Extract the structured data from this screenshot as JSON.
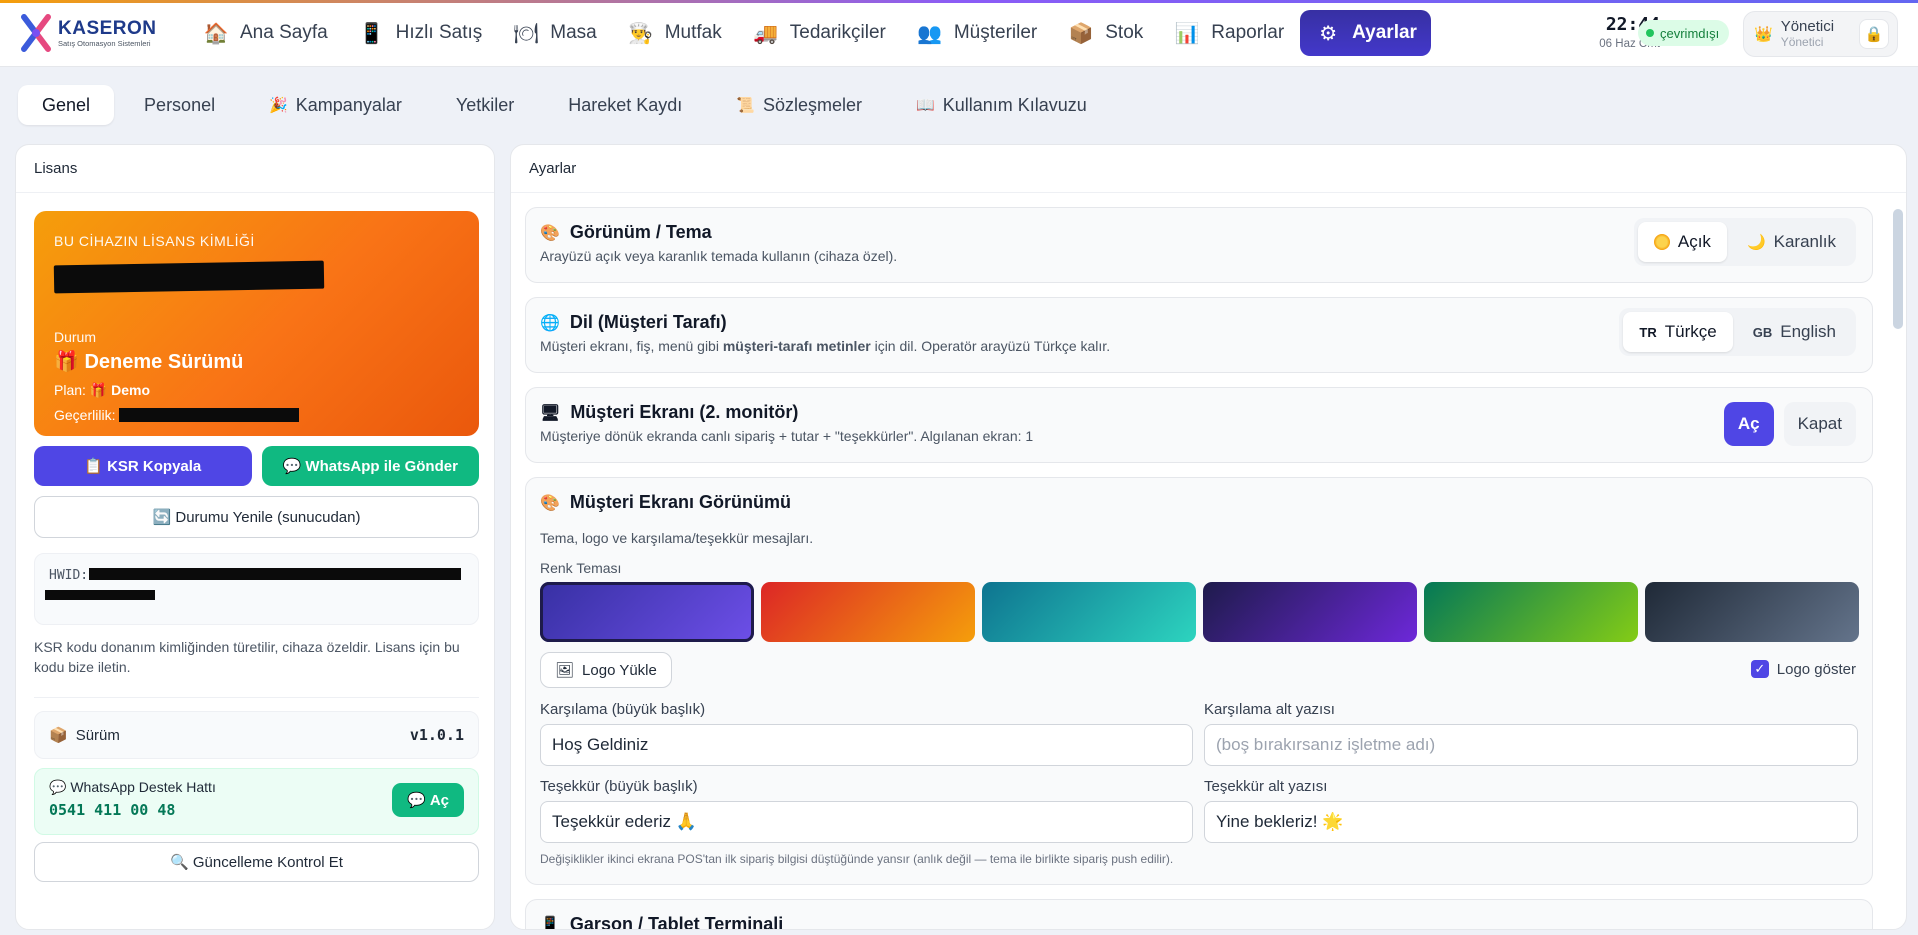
{
  "brand": {
    "name": "KASERON",
    "sub": "Satış Otomasyon Sistemleri"
  },
  "nav": [
    {
      "label": "Ana Sayfa",
      "icon": "🏠"
    },
    {
      "label": "Hızlı Satış",
      "icon": "📱"
    },
    {
      "label": "Masa",
      "icon": "🍽"
    },
    {
      "label": "Mutfak",
      "icon": "👨‍🍳"
    },
    {
      "label": "Tedarikçiler",
      "icon": "🚚"
    },
    {
      "label": "Müşteriler",
      "icon": "👥"
    },
    {
      "label": "Stok",
      "icon": "📦"
    },
    {
      "label": "Raporlar",
      "icon": "📊"
    },
    {
      "label": "Ayarlar",
      "icon": "⚙"
    }
  ],
  "clock": {
    "time": "22:44",
    "date": "06 Haz Cmt"
  },
  "connection": {
    "label": "çevrimdışı"
  },
  "user": {
    "name": "Yönetici",
    "role": "Yönetici"
  },
  "tabs": [
    {
      "label": "Genel",
      "icon": ""
    },
    {
      "label": "Personel",
      "icon": ""
    },
    {
      "label": "Kampanyalar",
      "icon": "🎉"
    },
    {
      "label": "Yetkiler",
      "icon": ""
    },
    {
      "label": "Hareket Kaydı",
      "icon": ""
    },
    {
      "label": "Sözleşmeler",
      "icon": "📜"
    },
    {
      "label": "Kullanım Kılavuzu",
      "icon": "📖"
    }
  ],
  "license": {
    "panel_title": "Lisans",
    "card_title": "BU CİHAZIN LİSANS KİMLİĞİ",
    "status_label": "Durum",
    "status": "Deneme Sürümü",
    "plan_label": "Plan:",
    "plan": "Demo",
    "valid_label": "Geçerlilik:",
    "copy_btn": "KSR Kopyala",
    "whatsapp_btn": "WhatsApp ile Gönder",
    "refresh_btn": "Durumu Yenile (sunucudan)",
    "hwid_label": "HWID:",
    "note": "KSR kodu donanım kimliğinden türetilir, cihaza özeldir. Lisans için bu kodu bize iletin.",
    "version_label": "Sürüm",
    "version": "v1.0.1",
    "support_title": "WhatsApp Destek Hattı",
    "support_phone": "0541 411 00 48",
    "support_open": "Aç",
    "update_btn": "Güncelleme Kontrol Et"
  },
  "settings": {
    "panel_title": "Ayarlar",
    "theme": {
      "title": "Görünüm / Tema",
      "desc": "Arayüzü açık veya karanlık temada kullanın (cihaza özel).",
      "light": "Açık",
      "dark": "Karanlık",
      "selected": "Açık"
    },
    "language": {
      "title": "Dil (Müşteri Tarafı)",
      "desc_pre": "Müşteri ekranı, fiş, menü gibi ",
      "desc_bold": "müşteri-tarafı metinler",
      "desc_post": " için dil. Operatör arayüzü Türkçe kalır.",
      "tr_code": "TR",
      "tr": "Türkçe",
      "en_code": "GB",
      "en": "English",
      "selected": "Türkçe"
    },
    "customer_display": {
      "title": "Müşteri Ekranı (2. monitör)",
      "desc": "Müşteriye dönük ekranda canlı sipariş + tutar + \"teşekkürler\". Algılanan ekran: 1",
      "on": "Aç",
      "off": "Kapat"
    },
    "display_look": {
      "title": "Müşteri Ekranı Görünümü",
      "desc": "Tema, logo ve karşılama/teşekkür mesajları.",
      "color_theme_label": "Renk Teması",
      "swatches": [
        {
          "from": "#3730a3",
          "to": "#6d4fe8",
          "selected": true
        },
        {
          "from": "#dc2626",
          "to": "#f59e0b",
          "selected": false
        },
        {
          "from": "#0e7490",
          "to": "#2dd4bf",
          "selected": false
        },
        {
          "from": "#1e1b4b",
          "to": "#6d28d9",
          "selected": false
        },
        {
          "from": "#047857",
          "to": "#84cc16",
          "selected": false
        },
        {
          "from": "#1f2937",
          "to": "#64748b",
          "selected": false
        }
      ],
      "logo_btn": "Logo Yükle",
      "show_logo": "Logo göster",
      "show_logo_checked": true,
      "welcome_title_label": "Karşılama (büyük başlık)",
      "welcome_title_value": "Hoş Geldiniz",
      "welcome_sub_label": "Karşılama alt yazısı",
      "welcome_sub_placeholder": "(boş bırakırsanız işletme adı)",
      "thanks_title_label": "Teşekkür (büyük başlık)",
      "thanks_title_value": "Teşekkür ederiz 🙏",
      "thanks_sub_label": "Teşekkür alt yazısı",
      "thanks_sub_value": "Yine bekleriz! 🌟",
      "footnote": "Değişiklikler ikinci ekrana POS'tan ilk sipariş bilgisi düştüğünde yansır (anlık değil — tema ile birlikte sipariş push edilir)."
    },
    "next_section_title": "Garson / Tablet Terminali"
  }
}
